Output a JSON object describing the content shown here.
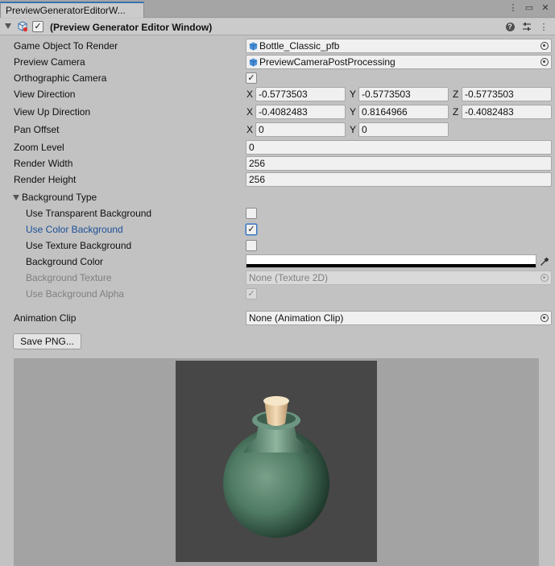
{
  "tab": {
    "title": "PreviewGeneratorEditorW..."
  },
  "header": {
    "title": "(Preview Generator Editor Window)",
    "enabled_check": "✓"
  },
  "fields": {
    "game_object": {
      "label": "Game Object To Render",
      "value": "Bottle_Classic_pfb"
    },
    "preview_camera": {
      "label": "Preview Camera",
      "value": "PreviewCameraPostProcessing"
    },
    "orthographic": {
      "label": "Orthographic Camera",
      "check": "✓"
    },
    "view_direction": {
      "label": "View Direction",
      "x": "-0.5773503",
      "y": "-0.5773503",
      "z": "-0.5773503"
    },
    "view_up_direction": {
      "label": "View Up Direction",
      "x": "-0.4082483",
      "y": "0.8164966",
      "z": "-0.4082483"
    },
    "pan_offset": {
      "label": "Pan Offset",
      "x": "0",
      "y": "0"
    },
    "zoom_level": {
      "label": "Zoom Level",
      "value": "0"
    },
    "render_width": {
      "label": "Render Width",
      "value": "256"
    },
    "render_height": {
      "label": "Render Height",
      "value": "256"
    }
  },
  "axes": {
    "x": "X",
    "y": "Y",
    "z": "Z"
  },
  "background": {
    "foldout_label": "Background Type",
    "use_transparent": {
      "label": "Use Transparent Background",
      "check": ""
    },
    "use_color": {
      "label": "Use Color Background",
      "check": "✓"
    },
    "use_texture": {
      "label": "Use Texture Background",
      "check": ""
    },
    "color": {
      "label": "Background Color",
      "value": "#ffffff",
      "alpha": 1.0
    },
    "texture": {
      "label": "Background Texture",
      "value": "None (Texture 2D)"
    },
    "use_alpha": {
      "label": "Use Background Alpha",
      "check": "✓"
    }
  },
  "animation_clip": {
    "label": "Animation Clip",
    "value": "None (Animation Clip)"
  },
  "save_button": {
    "label": "Save PNG..."
  },
  "colors": {
    "accent": "#3a72b0",
    "panel": "#c2c2c2",
    "preview_bg": "#474747"
  },
  "icons": {
    "tab_menu": "kebab-menu-icon",
    "tab_maximize": "maximize-icon",
    "tab_close": "close-icon",
    "help": "help-icon",
    "presets": "preset-sliders-icon",
    "more": "kebab-menu-icon",
    "script": "script-cube-icon",
    "object_picker": "object-picker-icon",
    "eyedropper": "eyedropper-icon",
    "prefab": "prefab-cube-icon"
  }
}
